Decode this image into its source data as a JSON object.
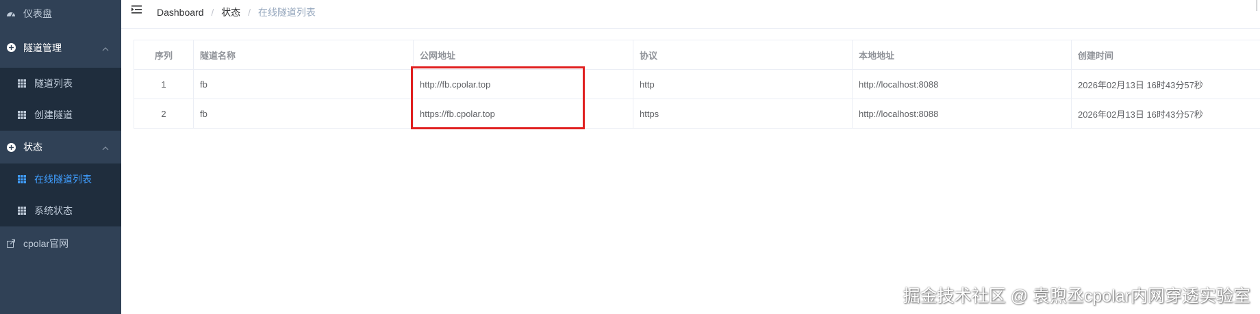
{
  "sidebar": {
    "dashboard": "仪表盘",
    "tunnel_management": {
      "title": "隧道管理",
      "items": [
        "隧道列表",
        "创建隧道"
      ]
    },
    "status": {
      "title": "状态",
      "items": [
        "在线隧道列表",
        "系统状态"
      ],
      "active_index": 0
    },
    "website": "cpolar官网"
  },
  "breadcrumb": {
    "items": [
      "Dashboard",
      "状态",
      "在线隧道列表"
    ],
    "separator": "/"
  },
  "table": {
    "headers": [
      "序列",
      "隧道名称",
      "公网地址",
      "协议",
      "本地地址",
      "创建时间"
    ],
    "rows": [
      [
        "1",
        "fb",
        "http://fb.cpolar.top",
        "http",
        "http://localhost:8088",
        "2026年02月13日 16时43分57秒"
      ],
      [
        "2",
        "fb",
        "https://fb.cpolar.top",
        "https",
        "http://localhost:8088",
        "2026年02月13日 16时43分57秒"
      ]
    ]
  },
  "watermark": "掘金技术社区 @ 袁煦丞cpolar内网穿透实验室",
  "colors": {
    "sidebar_bg": "#304156",
    "submenu_bg": "#1f2d3d",
    "active": "#409eff",
    "highlight": "#e02020"
  }
}
